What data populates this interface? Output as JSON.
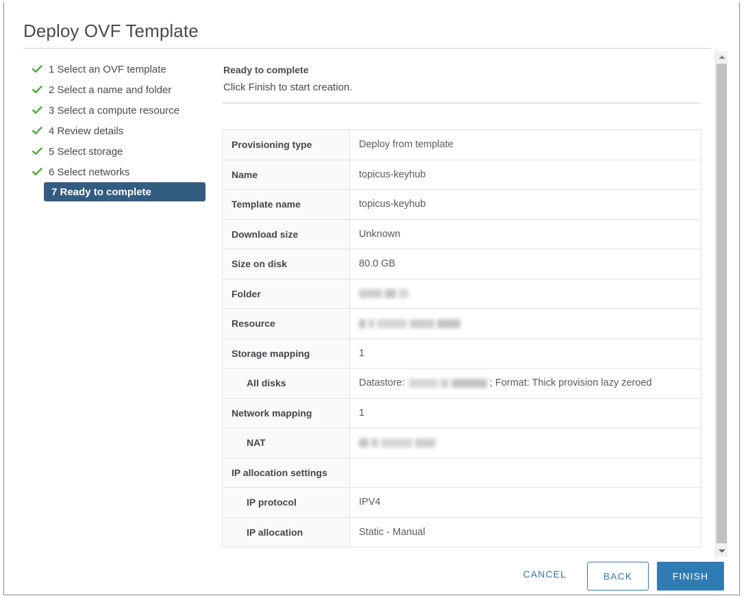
{
  "dialog": {
    "title": "Deploy OVF Template"
  },
  "steps": [
    {
      "number": "1",
      "label": "1 Select an OVF template",
      "state": "complete",
      "icon": "check-icon"
    },
    {
      "number": "2",
      "label": "2 Select a name and folder",
      "state": "complete",
      "icon": "check-icon"
    },
    {
      "number": "3",
      "label": "3 Select a compute resource",
      "state": "complete",
      "icon": "check-icon"
    },
    {
      "number": "4",
      "label": "4 Review details",
      "state": "complete",
      "icon": "check-icon"
    },
    {
      "number": "5",
      "label": "5 Select storage",
      "state": "complete",
      "icon": "check-icon"
    },
    {
      "number": "6",
      "label": "6 Select networks",
      "state": "complete",
      "icon": "check-icon"
    },
    {
      "number": "7",
      "label": "7 Ready to complete",
      "state": "active",
      "icon": "none"
    }
  ],
  "content": {
    "heading": "Ready to complete",
    "subheading": "Click Finish to start creation."
  },
  "summary_rows": [
    {
      "label": "Provisioning type",
      "value": "Deploy from template",
      "indent": false,
      "redacted": false
    },
    {
      "label": "Name",
      "value": "topicus-keyhub",
      "indent": false,
      "redacted": false
    },
    {
      "label": "Template name",
      "value": "topicus-keyhub",
      "indent": false,
      "redacted": false
    },
    {
      "label": "Download size",
      "value": "Unknown",
      "indent": false,
      "redacted": false
    },
    {
      "label": "Size on disk",
      "value": "80.0 GB",
      "indent": false,
      "redacted": false
    },
    {
      "label": "Folder",
      "value": "",
      "indent": false,
      "redacted": true,
      "redact_widths": [
        34,
        16,
        14
      ]
    },
    {
      "label": "Resource",
      "value": "",
      "indent": false,
      "redacted": true,
      "redact_widths": [
        10,
        8,
        44,
        36,
        34
      ]
    },
    {
      "label": "Storage mapping",
      "value": "1",
      "indent": false,
      "redacted": false
    },
    {
      "label": "All disks",
      "value": "",
      "indent": true,
      "redacted": "mixed",
      "prefix": "Datastore:",
      "suffix": "; Format: Thick provision lazy zeroed",
      "redact_widths": [
        42,
        12,
        52
      ]
    },
    {
      "label": "Network mapping",
      "value": "1",
      "indent": false,
      "redacted": false
    },
    {
      "label": "NAT",
      "value": "",
      "indent": true,
      "redacted": true,
      "redact_widths": [
        14,
        10,
        46,
        30
      ]
    },
    {
      "label": "IP allocation settings",
      "value": "",
      "indent": false,
      "redacted": false
    },
    {
      "label": "IP protocol",
      "value": "IPV4",
      "indent": true,
      "redacted": false
    },
    {
      "label": "IP allocation",
      "value": "Static - Manual",
      "indent": true,
      "redacted": false
    }
  ],
  "scrollbar": {
    "up_icon": "chevron-up-icon",
    "down_icon": "chevron-down-icon"
  },
  "footer": {
    "cancel_label": "CANCEL",
    "back_label": "BACK",
    "finish_label": "FINISH"
  },
  "colors": {
    "active_step_bg": "#335c81",
    "check_green": "#4aa833",
    "primary_blue": "#2f7cb4",
    "link_blue": "#3471a6",
    "text": "#4a4a4a"
  }
}
